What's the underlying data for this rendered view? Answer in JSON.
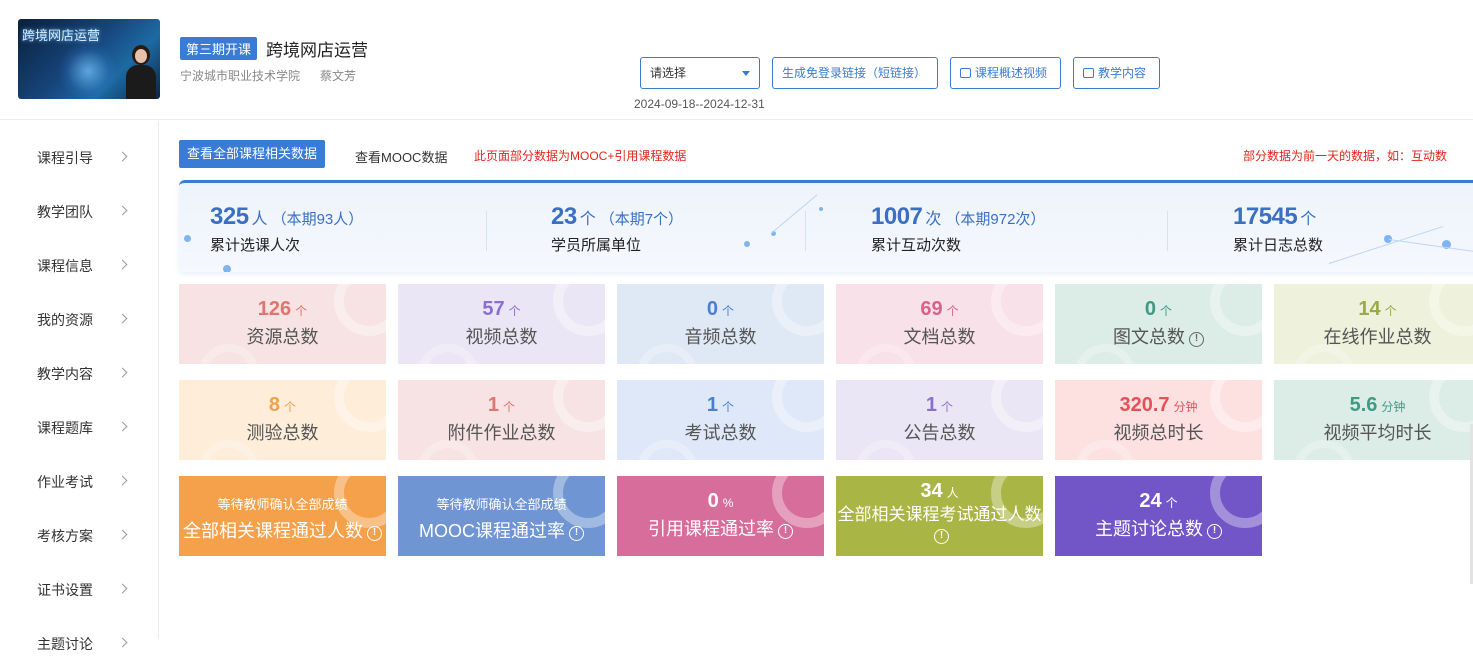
{
  "header": {
    "thumbnail_text": "跨境网店运营",
    "term_badge": "第三期开课",
    "course_title": "跨境网店运营",
    "school": "宁波城市职业技术学院",
    "teacher": "蔡文芳",
    "select_placeholder": "请选择",
    "btn_link": "生成免登录链接（短链接）",
    "btn_video": "课程概述视频",
    "btn_content": "教学内容",
    "dates": "2024-09-18--2024-12-31"
  },
  "sidebar": {
    "items": [
      {
        "label": "课程引导"
      },
      {
        "label": "教学团队"
      },
      {
        "label": "课程信息"
      },
      {
        "label": "我的资源"
      },
      {
        "label": "教学内容"
      },
      {
        "label": "课程题库"
      },
      {
        "label": "作业考试"
      },
      {
        "label": "考核方案"
      },
      {
        "label": "证书设置"
      },
      {
        "label": "主题讨论"
      }
    ]
  },
  "toolbar": {
    "tab_all": "查看全部课程相关数据",
    "tab_mooc": "查看MOOC数据",
    "note_left": "此页面部分数据为MOOC+引用课程数据",
    "note_right": "部分数据为前一天的数据，如：互动数"
  },
  "summary": [
    {
      "value": "325",
      "unit": "人",
      "sub": "（本期93人）",
      "label": "累计选课人次"
    },
    {
      "value": "23",
      "unit": "个",
      "sub": "（本期7个）",
      "label": "学员所属单位"
    },
    {
      "value": "1007",
      "unit": "次",
      "sub": "（本期972次）",
      "label": "累计互动次数"
    },
    {
      "value": "17545",
      "unit": "个",
      "sub": "",
      "label": "累计日志总数"
    }
  ],
  "cards_row1": [
    {
      "value": "126",
      "unit": "个",
      "label": "资源总数",
      "color": "#e0746e",
      "bg": "#f7e3e3"
    },
    {
      "value": "57",
      "unit": "个",
      "label": "视频总数",
      "color": "#8a6fd2",
      "bg": "#ebe6f5"
    },
    {
      "value": "0",
      "unit": "个",
      "label": "音频总数",
      "color": "#4a7fd0",
      "bg": "#dfe8f5"
    },
    {
      "value": "69",
      "unit": "个",
      "label": "文档总数",
      "color": "#d9628a",
      "bg": "#f9e1e9"
    },
    {
      "value": "0",
      "unit": "个",
      "label": "图文总数",
      "color": "#3f9a83",
      "bg": "#dcece7"
    },
    {
      "value": "14",
      "unit": "个",
      "label": "在线作业总数",
      "color": "#9aab46",
      "bg": "#eef1dc"
    }
  ],
  "cards_row2": [
    {
      "value": "8",
      "unit": "个",
      "label": "测验总数",
      "color": "#f0a24e",
      "bg": "#fdedd9"
    },
    {
      "value": "1",
      "unit": "个",
      "label": "附件作业总数",
      "color": "#e0746e",
      "bg": "#f7e3e3"
    },
    {
      "value": "1",
      "unit": "个",
      "label": "考试总数",
      "color": "#4a7fd0",
      "bg": "#dfe8f8"
    },
    {
      "value": "1",
      "unit": "个",
      "label": "公告总数",
      "color": "#8a6fd2",
      "bg": "#ebe6f5"
    },
    {
      "value": "320.7",
      "unit": "分钟",
      "label": "视频总时长",
      "color": "#e6505a",
      "bg": "#fde1e1"
    },
    {
      "value": "5.6",
      "unit": "分钟",
      "label": "视频平均时长",
      "color": "#3f9a83",
      "bg": "#dcece7"
    }
  ],
  "cards_row3": [
    {
      "top": "等待教师确认全部成绩",
      "label": "全部相关课程通过人数",
      "bg": "#f5a04a"
    },
    {
      "top": "等待教师确认全部成绩",
      "label": "MOOC课程通过率",
      "bg": "#6f95d2"
    },
    {
      "value": "0",
      "unit": "%",
      "label": "引用课程通过率",
      "bg": "#d76d9a"
    },
    {
      "value": "34",
      "unit": "人",
      "label": "全部相关课程考试通过人数",
      "bg": "#a9b545"
    },
    {
      "value": "24",
      "unit": "个",
      "label": "主题讨论总数",
      "bg": "#7255c7"
    }
  ],
  "icons": {
    "info": "!"
  }
}
